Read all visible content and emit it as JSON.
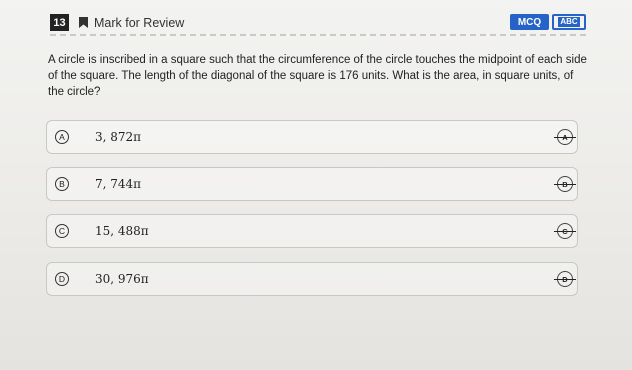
{
  "header": {
    "question_number": "13",
    "mark_label": "Mark for Review",
    "mcq_badge": "MCQ",
    "abc_badge": "ABC"
  },
  "question": {
    "text": "A circle is inscribed in a square such that the circumference of the circle touches the midpoint of each side of the square. The length of the diagonal of the square is 176 units. What is the area, in square units, of the circle?"
  },
  "options": [
    {
      "letter": "A",
      "value": "3, 872π",
      "strike_label": "A"
    },
    {
      "letter": "B",
      "value": "7, 744π",
      "strike_label": "B"
    },
    {
      "letter": "C",
      "value": "15, 488π",
      "strike_label": "C"
    },
    {
      "letter": "D",
      "value": "30, 976π",
      "strike_label": "D"
    }
  ],
  "icons": {
    "bookmark": "bookmark-icon",
    "strikethrough": "strikethrough-icon"
  },
  "colors": {
    "accent": "#2563c9"
  }
}
